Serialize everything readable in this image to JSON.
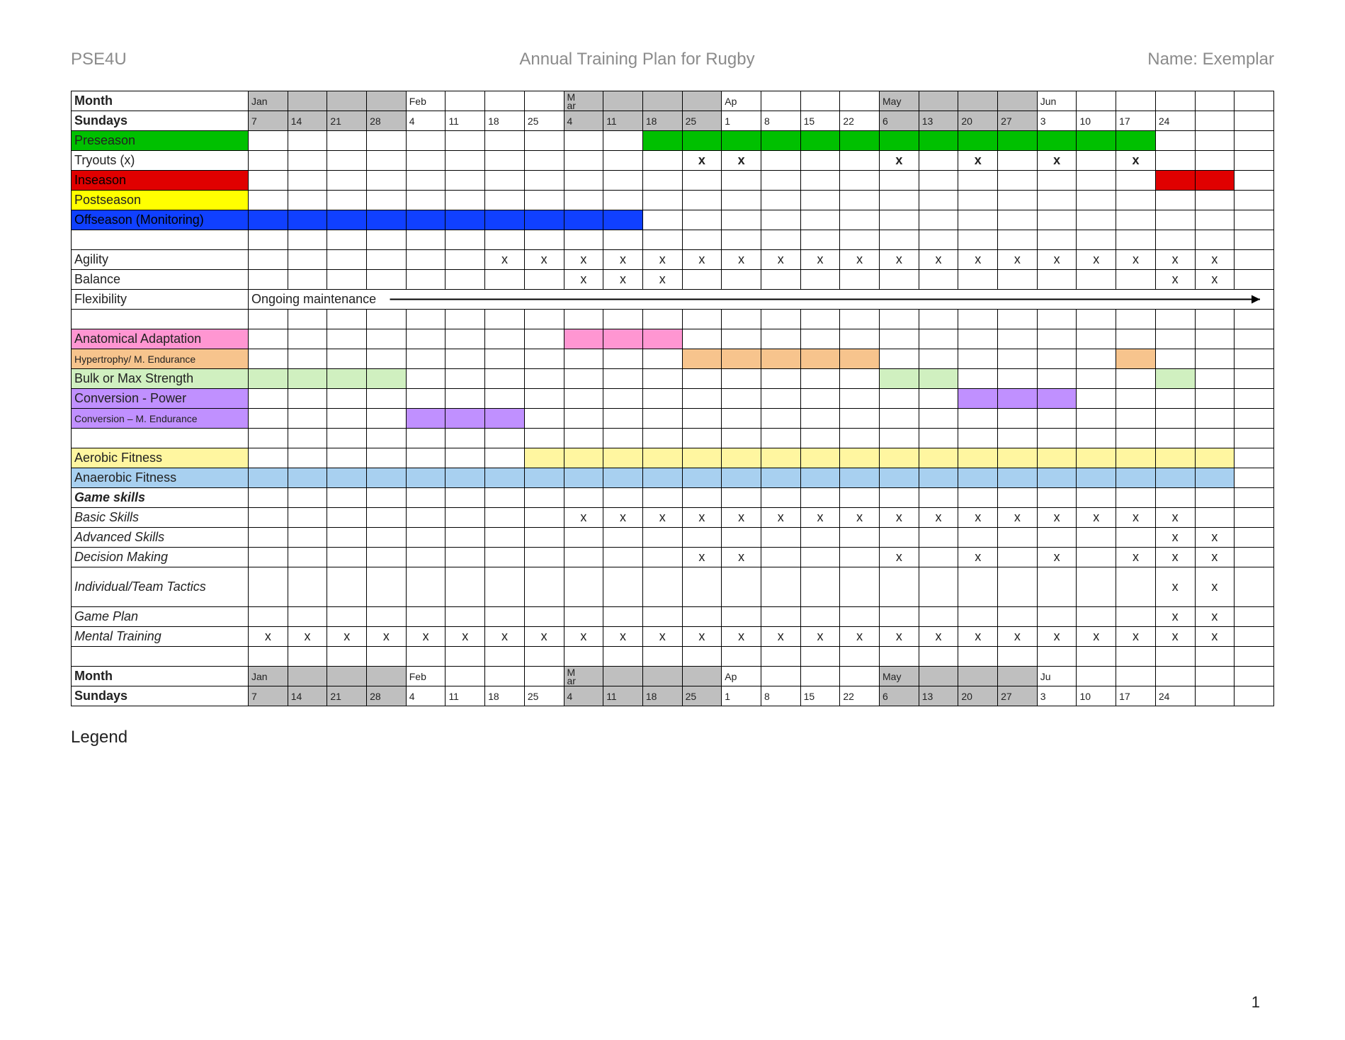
{
  "header": {
    "left": "PSE4U",
    "center": "Annual Training Plan for Rugby",
    "right": "Name: Exemplar"
  },
  "legend": "Legend",
  "page_number": "1",
  "label_col_width": 250,
  "n_cols": 26,
  "month_row": {
    "label": "Month",
    "cells": [
      {
        "t": "Jan",
        "g": 1
      },
      {
        "g": 1
      },
      {
        "g": 1
      },
      {
        "g": 1
      },
      {
        "t": "Feb"
      },
      {
        "t": ""
      },
      {
        "t": ""
      },
      {
        "t": ""
      },
      {
        "t": "Mar",
        "g": 1,
        "wrap": 1
      },
      {
        "g": 1
      },
      {
        "g": 1
      },
      {
        "g": 1
      },
      {
        "t": "Ap"
      },
      {
        "t": ""
      },
      {
        "t": ""
      },
      {
        "t": ""
      },
      {
        "t": "May",
        "g": 1
      },
      {
        "g": 1
      },
      {
        "g": 1
      },
      {
        "g": 1
      },
      {
        "t": "Jun"
      },
      {
        "t": ""
      },
      {
        "t": ""
      },
      {
        "t": ""
      },
      {
        "t": ""
      },
      {
        "t": ""
      }
    ]
  },
  "sunday_row": {
    "label": "Sundays",
    "cells": [
      {
        "t": "7",
        "g": 1
      },
      {
        "t": "14",
        "g": 1
      },
      {
        "t": "21",
        "g": 1
      },
      {
        "t": "28",
        "g": 1
      },
      {
        "t": "4"
      },
      {
        "t": "11"
      },
      {
        "t": "18"
      },
      {
        "t": "25"
      },
      {
        "t": "4",
        "g": 1
      },
      {
        "t": "11",
        "g": 1
      },
      {
        "t": "18",
        "g": 1
      },
      {
        "t": "25",
        "g": 1
      },
      {
        "t": "1"
      },
      {
        "t": "8"
      },
      {
        "t": "15"
      },
      {
        "t": "22"
      },
      {
        "t": "6",
        "g": 1
      },
      {
        "t": "13",
        "g": 1
      },
      {
        "t": "20",
        "g": 1
      },
      {
        "t": "27",
        "g": 1
      },
      {
        "t": "3"
      },
      {
        "t": "10"
      },
      {
        "t": "17"
      },
      {
        "t": "24"
      },
      {
        "t": ""
      },
      {
        "t": ""
      }
    ]
  },
  "month_row2": {
    "label": "Month",
    "cells": [
      {
        "t": "Jan",
        "g": 1
      },
      {
        "g": 1
      },
      {
        "g": 1
      },
      {
        "g": 1
      },
      {
        "t": "Feb"
      },
      {
        "t": ""
      },
      {
        "t": ""
      },
      {
        "t": ""
      },
      {
        "t": "Mar",
        "g": 1,
        "wrap": 1
      },
      {
        "g": 1
      },
      {
        "g": 1
      },
      {
        "g": 1
      },
      {
        "t": "Ap"
      },
      {
        "t": ""
      },
      {
        "t": ""
      },
      {
        "t": ""
      },
      {
        "t": "May",
        "g": 1
      },
      {
        "g": 1
      },
      {
        "g": 1
      },
      {
        "g": 1
      },
      {
        "t": "Ju"
      },
      {
        "t": ""
      },
      {
        "t": ""
      },
      {
        "t": ""
      },
      {
        "t": ""
      },
      {
        "t": ""
      }
    ]
  },
  "rows": [
    {
      "label": "Preseason",
      "lblbg": "#00c000",
      "fills": {
        "10": "#00c000",
        "11": "#00c000",
        "12": "#00c000",
        "13": "#00c000",
        "14": "#00c000",
        "15": "#00c000",
        "16": "#00c000",
        "17": "#00c000",
        "18": "#00c000",
        "19": "#00c000",
        "20": "#00c000",
        "21": "#00c000",
        "22": "#00c000"
      }
    },
    {
      "label": "Tryouts (x)",
      "meta": {
        "bold_x": 1
      },
      "x": [
        11,
        12,
        16,
        18,
        20,
        22
      ]
    },
    {
      "label": "Inseason",
      "lblbg": "#e00000",
      "lblfg": "#000",
      "fills": {
        "23": "#e00000",
        "24": "#e00000"
      }
    },
    {
      "label": "Postseason",
      "lblbg": "#ffff00"
    },
    {
      "label": "Offseason (Monitoring)",
      "lblbg": "#1040ff",
      "lblfg": "#000",
      "fills": {
        "0": "#1040ff",
        "1": "#1040ff",
        "2": "#1040ff",
        "3": "#1040ff",
        "4": "#1040ff",
        "5": "#1040ff",
        "6": "#1040ff",
        "7": "#1040ff",
        "8": "#1040ff",
        "9": "#1040ff"
      }
    },
    {
      "label": ""
    },
    {
      "label": "Agility",
      "x": [
        6,
        7,
        8,
        9,
        10,
        11,
        12,
        13,
        14,
        15,
        16,
        17,
        18,
        19,
        20,
        21,
        22,
        23,
        24
      ]
    },
    {
      "label": "Balance",
      "x": [
        8,
        9,
        10,
        23,
        24
      ]
    },
    {
      "label": "Flexibility",
      "note": "Ongoing maintenance",
      "arrow": 1
    },
    {
      "label": ""
    },
    {
      "label": "Anatomical Adaptation",
      "lblbg": "#ff96d2",
      "fills": {
        "8": "#ff96d2",
        "9": "#ff96d2",
        "10": "#ff96d2"
      }
    },
    {
      "label": "Hypertrophy/ M. Endurance",
      "lblbg": "#f7c48d",
      "sm": 1,
      "fills": {
        "11": "#f7c48d",
        "12": "#f7c48d",
        "13": "#f7c48d",
        "14": "#f7c48d",
        "15": "#f7c48d",
        "22": "#f7c48d"
      }
    },
    {
      "label": "Bulk or Max Strength",
      "lblbg": "#d0f0c0",
      "fills": {
        "0": "#d0f0c0",
        "1": "#d0f0c0",
        "2": "#d0f0c0",
        "3": "#d0f0c0",
        "16": "#d0f0c0",
        "17": "#d0f0c0",
        "23": "#d0f0c0"
      }
    },
    {
      "label": "Conversion - Power",
      "lblbg": "#c090ff",
      "fills": {
        "18": "#c090ff",
        "19": "#c090ff",
        "20": "#c090ff"
      }
    },
    {
      "label": "Conversion – M. Endurance",
      "lblbg": "#c090ff",
      "sm": 1,
      "fills": {
        "4": "#c090ff",
        "5": "#c090ff",
        "6": "#c090ff"
      }
    },
    {
      "label": ""
    },
    {
      "label": "Aerobic Fitness",
      "lblbg": "#fff6a0",
      "fills": {
        "7": "#fff6a0",
        "8": "#fff6a0",
        "9": "#fff6a0",
        "10": "#fff6a0",
        "11": "#fff6a0",
        "12": "#fff6a0",
        "13": "#fff6a0",
        "14": "#fff6a0",
        "15": "#fff6a0",
        "16": "#fff6a0",
        "17": "#fff6a0",
        "18": "#fff6a0",
        "19": "#fff6a0",
        "20": "#fff6a0",
        "21": "#fff6a0",
        "22": "#fff6a0",
        "23": "#fff6a0",
        "24": "#fff6a0"
      }
    },
    {
      "label": "Anaerobic Fitness",
      "lblbg": "#a8d0f0",
      "fills": {
        "0": "#a8d0f0",
        "1": "#a8d0f0",
        "2": "#a8d0f0",
        "3": "#a8d0f0",
        "4": "#a8d0f0",
        "5": "#a8d0f0",
        "6": "#a8d0f0",
        "7": "#a8d0f0",
        "8": "#a8d0f0",
        "9": "#a8d0f0",
        "10": "#a8d0f0",
        "11": "#a8d0f0",
        "12": "#a8d0f0",
        "13": "#a8d0f0",
        "14": "#a8d0f0",
        "15": "#a8d0f0",
        "16": "#a8d0f0",
        "17": "#a8d0f0",
        "18": "#a8d0f0",
        "19": "#a8d0f0",
        "20": "#a8d0f0",
        "21": "#a8d0f0",
        "22": "#a8d0f0",
        "23": "#a8d0f0",
        "24": "#a8d0f0"
      }
    },
    {
      "label": "Game skills",
      "bi": 1
    },
    {
      "label": "Basic Skills",
      "it": 1,
      "x": [
        8,
        9,
        10,
        11,
        12,
        13,
        14,
        15,
        16,
        17,
        18,
        19,
        20,
        21,
        22,
        23
      ]
    },
    {
      "label": "Advanced Skills",
      "it": 1,
      "x": [
        23,
        24
      ]
    },
    {
      "label": "Decision Making",
      "it": 1,
      "x": [
        11,
        12,
        16,
        18,
        20,
        22,
        23,
        24
      ]
    },
    {
      "label": "Individual/Team Tactics",
      "it": 1,
      "tall": 1,
      "x": [
        23,
        24
      ]
    },
    {
      "label": "Game Plan",
      "it": 1,
      "x": [
        23,
        24
      ]
    },
    {
      "label": "Mental Training",
      "it": 1,
      "x": [
        0,
        1,
        2,
        3,
        4,
        5,
        6,
        7,
        8,
        9,
        10,
        11,
        12,
        13,
        14,
        15,
        16,
        17,
        18,
        19,
        20,
        21,
        22,
        23,
        24
      ]
    },
    {
      "label": ""
    }
  ]
}
